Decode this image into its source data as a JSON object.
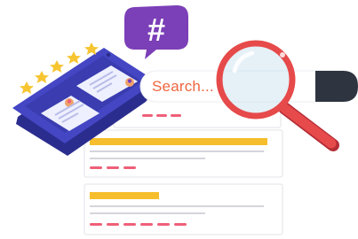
{
  "search": {
    "placeholder": "Search..."
  },
  "hashtag": {
    "symbol": "#"
  },
  "rating": {
    "stars": 5,
    "max": 5
  },
  "icons": {
    "hashtag": "hashtag-icon",
    "magnifier": "magnifying-glass-icon",
    "star": "star-icon"
  },
  "colors": {
    "accent_purple": "#7b3fb7",
    "phone_blue": "#3d3fb3",
    "search_text": "#f0663f",
    "magnifier_red": "#e64a4a",
    "result_yellow": "#f6be2c",
    "result_pink": "#ef5f78",
    "star_yellow": "#f7c531"
  }
}
